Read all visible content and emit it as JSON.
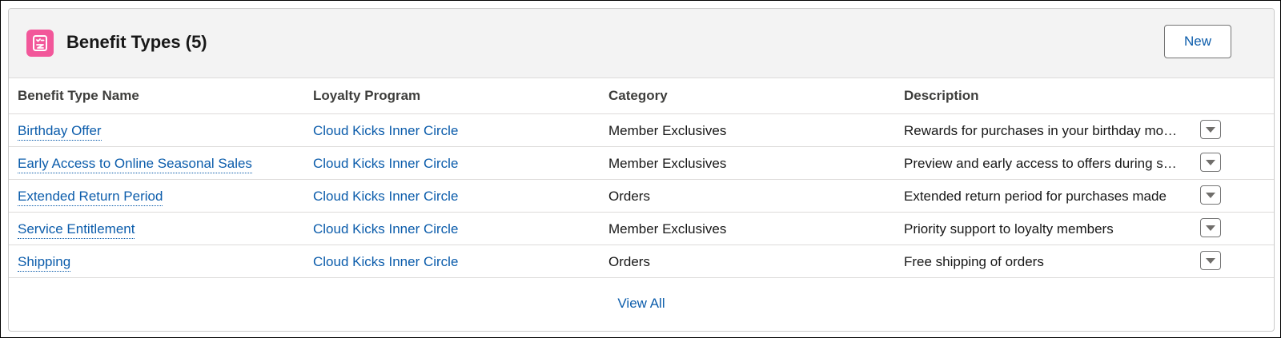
{
  "card": {
    "title": "Benefit Types (5)",
    "icon": "benefit-icon",
    "new_label": "New",
    "view_all_label": "View All",
    "accent_color": "#f2579a",
    "link_color": "#0b5cab"
  },
  "table": {
    "columns": [
      "Benefit Type Name",
      "Loyalty Program",
      "Category",
      "Description"
    ],
    "rows": [
      {
        "name": "Birthday Offer",
        "program": "Cloud Kicks Inner Circle",
        "category": "Member Exclusives",
        "description": "Rewards for purchases in your birthday month"
      },
      {
        "name": "Early Access to Online Seasonal Sales",
        "program": "Cloud Kicks Inner Circle",
        "category": "Member Exclusives",
        "description": "Preview and early access to offers during seasonal sales"
      },
      {
        "name": "Extended Return Period",
        "program": "Cloud Kicks Inner Circle",
        "category": "Orders",
        "description": "Extended return period for purchases made"
      },
      {
        "name": "Service Entitlement",
        "program": "Cloud Kicks Inner Circle",
        "category": "Member Exclusives",
        "description": "Priority support to loyalty members"
      },
      {
        "name": "Shipping",
        "program": "Cloud Kicks Inner Circle",
        "category": "Orders",
        "description": "Free shipping of orders"
      }
    ]
  }
}
